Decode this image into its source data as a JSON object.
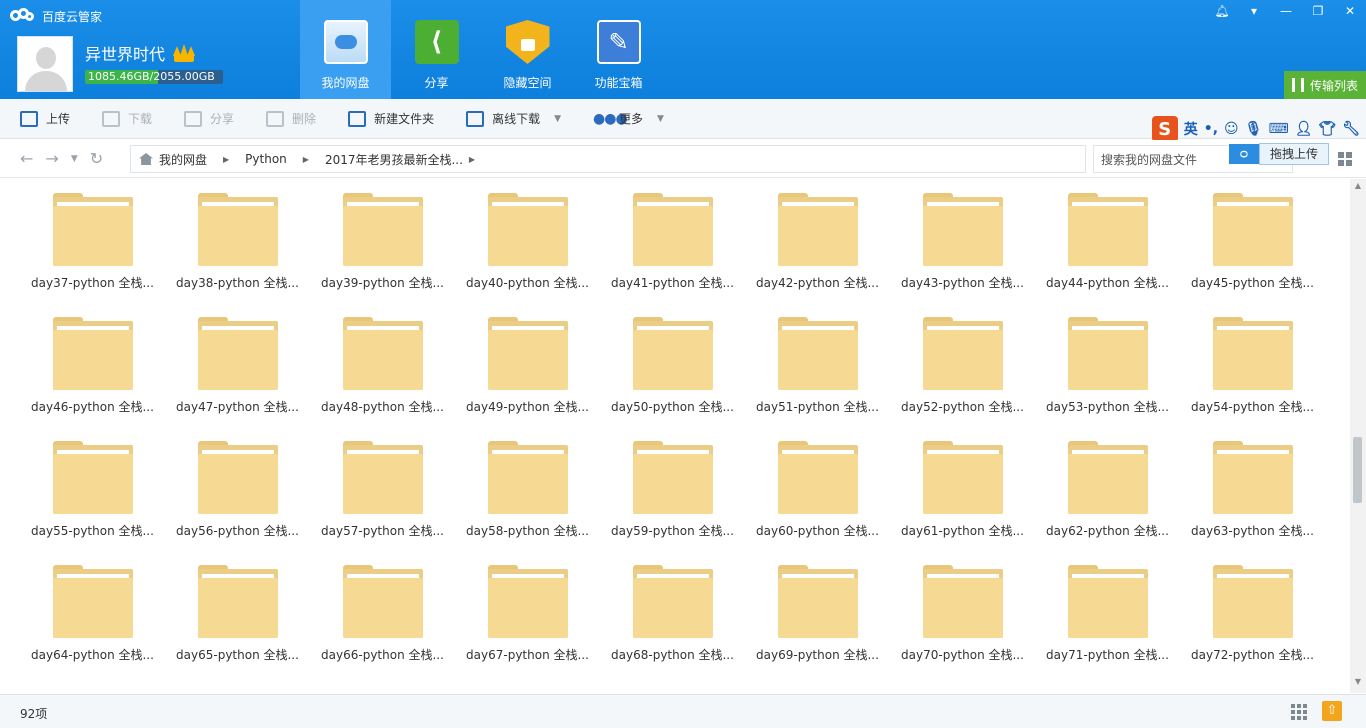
{
  "app": {
    "title": "百度云管家",
    "window_controls": [
      "bell",
      "menu",
      "minimize",
      "restore",
      "close"
    ]
  },
  "user": {
    "name": "异世界时代",
    "quota_used": "1085.46GB",
    "quota_total": "/2055.00GB",
    "quota_fraction": 0.528
  },
  "main_tabs": [
    {
      "label": "我的网盘",
      "icon": "cloud-icon",
      "active": true
    },
    {
      "label": "分享",
      "icon": "share-icon",
      "active": false
    },
    {
      "label": "隐藏空间",
      "icon": "lock-icon",
      "active": false
    },
    {
      "label": "功能宝箱",
      "icon": "toolbox-icon",
      "active": false
    }
  ],
  "transfer_label": "传输列表",
  "toolbar": {
    "upload": "上传",
    "download": "下载",
    "share": "分享",
    "delete": "删除",
    "new_folder": "新建文件夹",
    "offline_download": "离线下载",
    "more": "更多"
  },
  "ime": {
    "lang": "英"
  },
  "breadcrumb": [
    "我的网盘",
    "Python",
    "2017年老男孩最新全栈..."
  ],
  "search": {
    "placeholder": "搜索我的网盘文件"
  },
  "upload_tip": "拖拽上传",
  "folders": [
    "day37-python 全栈...",
    "day38-python 全栈...",
    "day39-python 全栈...",
    "day40-python 全栈...",
    "day41-python 全栈...",
    "day42-python 全栈...",
    "day43-python 全栈...",
    "day44-python 全栈...",
    "day45-python 全栈...",
    "day46-python 全栈...",
    "day47-python 全栈...",
    "day48-python 全栈...",
    "day49-python 全栈...",
    "day50-python 全栈...",
    "day51-python 全栈...",
    "day52-python 全栈...",
    "day53-python 全栈...",
    "day54-python 全栈...",
    "day55-python 全栈...",
    "day56-python 全栈...",
    "day57-python 全栈...",
    "day58-python 全栈...",
    "day59-python 全栈...",
    "day60-python 全栈...",
    "day61-python 全栈...",
    "day62-python 全栈...",
    "day63-python 全栈...",
    "day64-python 全栈...",
    "day65-python 全栈...",
    "day66-python 全栈...",
    "day67-python 全栈...",
    "day68-python 全栈...",
    "day69-python 全栈...",
    "day70-python 全栈...",
    "day71-python 全栈...",
    "day72-python 全栈..."
  ],
  "status": {
    "count": "92项"
  }
}
